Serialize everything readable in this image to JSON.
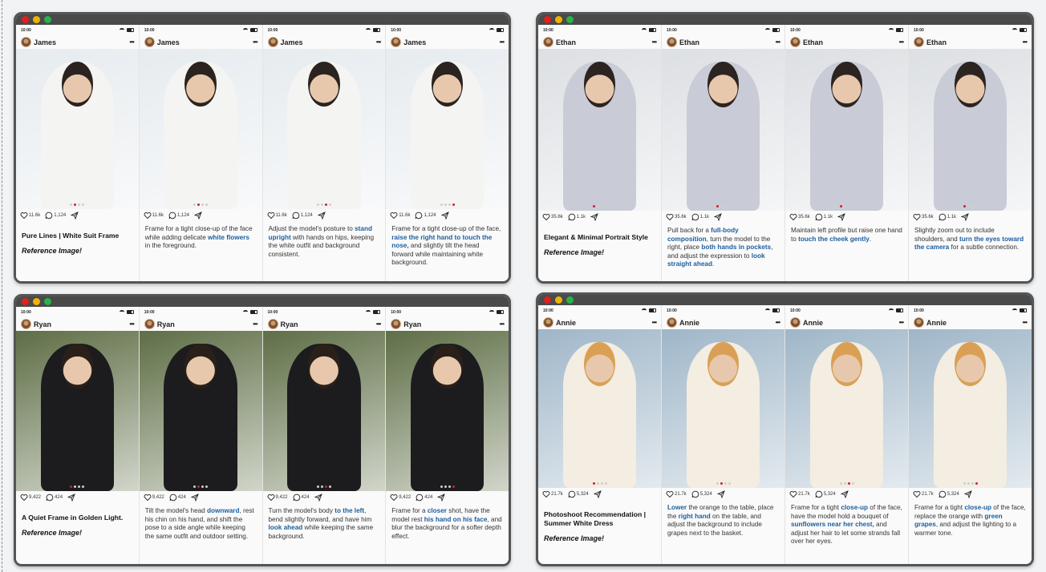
{
  "status_time": "10:00",
  "windows": [
    {
      "id": "james",
      "user": "James",
      "likes": "11.6k",
      "comments": "1,124",
      "title": "Pure Lines | White Suit Frame",
      "reference": "Reference Image!",
      "theme": {
        "bg": "#e6ebef",
        "figure": "#f4f4f2",
        "head": "#2a2320"
      },
      "panels": [
        {
          "active_dot": 1,
          "caption": []
        },
        {
          "active_dot": 1,
          "caption": [
            {
              "t": "Frame for a tight close-up of the face while adding delicate "
            },
            {
              "t": "white flowers",
              "hl": true
            },
            {
              "t": " in the foreground."
            }
          ]
        },
        {
          "active_dot": 2,
          "caption": [
            {
              "t": "Adjust the model's posture to "
            },
            {
              "t": "stand upright",
              "hl": true
            },
            {
              "t": " with hands on hips, keeping the white outfit and background consistent."
            }
          ]
        },
        {
          "active_dot": 3,
          "caption": [
            {
              "t": "Frame for a tight close-up of the face, "
            },
            {
              "t": "raise the right hand to touch the nose,",
              "hl": true
            },
            {
              "t": " and slightly tilt the head forward while maintaining white background."
            }
          ]
        }
      ]
    },
    {
      "id": "ethan",
      "user": "Ethan",
      "likes": "35.6k",
      "comments": "1.1k",
      "title": "Elegant & Minimal Portrait Style",
      "reference": "Reference Image!",
      "theme": {
        "bg": "#dcdfe3",
        "figure": "#c9ccd6",
        "head": "#2c2420"
      },
      "panels": [
        {
          "active_dot": 0,
          "caption": []
        },
        {
          "active_dot": 0,
          "caption": [
            {
              "t": "Pull back for a "
            },
            {
              "t": "full-body composition",
              "hl": true
            },
            {
              "t": ", turn the model to the right, place "
            },
            {
              "t": "both hands in pockets",
              "hl": true
            },
            {
              "t": ", and adjust the expression to "
            },
            {
              "t": "look straight ahead",
              "hl": true
            },
            {
              "t": "."
            }
          ]
        },
        {
          "active_dot": 0,
          "caption": [
            {
              "t": "Maintain left profile but raise one hand to "
            },
            {
              "t": "touch the cheek gently",
              "hl": true
            },
            {
              "t": "."
            }
          ]
        },
        {
          "active_dot": 0,
          "caption": [
            {
              "t": "Slightly zoom out to include shoulders, and "
            },
            {
              "t": "turn the eyes toward the camera",
              "hl": true
            },
            {
              "t": " for a subtle connection."
            }
          ]
        }
      ]
    },
    {
      "id": "ryan",
      "user": "Ryan",
      "likes": "9,422",
      "comments": "424",
      "title": "A Quiet Frame in Golden Light.",
      "reference": "Reference Image!",
      "theme": {
        "bg": "#5e6e46",
        "figure": "#1c1c1e",
        "head": "#2a2019"
      },
      "panels": [
        {
          "active_dot": 0,
          "caption": []
        },
        {
          "active_dot": 1,
          "caption": [
            {
              "t": "Tilt the model's head "
            },
            {
              "t": "downward",
              "hl": true
            },
            {
              "t": ", rest his chin on his hand, and shift the pose to a side angle while keeping the same outfit and outdoor setting."
            }
          ]
        },
        {
          "active_dot": 2,
          "caption": [
            {
              "t": "Turn the model's body "
            },
            {
              "t": "to the left",
              "hl": true
            },
            {
              "t": ", bend slightly forward, and have him "
            },
            {
              "t": "look ahead",
              "hl": true
            },
            {
              "t": " while keeping the same background."
            }
          ]
        },
        {
          "active_dot": 3,
          "caption": [
            {
              "t": "Frame for a "
            },
            {
              "t": "closer",
              "hl": true
            },
            {
              "t": " shot, have the model rest "
            },
            {
              "t": "his hand on his face",
              "hl": true
            },
            {
              "t": ", and blur the background for a softer depth effect."
            }
          ]
        }
      ]
    },
    {
      "id": "annie",
      "user": "Annie",
      "likes": "21.7k",
      "comments": "5,324",
      "title": "Photoshoot Recommendation | Summer White Dress",
      "reference": "Reference Image!",
      "theme": {
        "bg": "#9fb6c8",
        "figure": "#f3ede2",
        "head": "#d9a055"
      },
      "panels": [
        {
          "active_dot": 0,
          "caption": []
        },
        {
          "active_dot": 1,
          "caption": [
            {
              "t": "Lower",
              "hl": true
            },
            {
              "t": " the orange to the table, place the "
            },
            {
              "t": "right hand",
              "hl": true
            },
            {
              "t": " on the table, and adjust the background to include grapes next to the basket."
            }
          ]
        },
        {
          "active_dot": 2,
          "caption": [
            {
              "t": "Frame for a tight "
            },
            {
              "t": "close-up",
              "hl": true
            },
            {
              "t": " of the face, have the model hold a bouquet of "
            },
            {
              "t": "sunflowers near her chest,",
              "hl": true
            },
            {
              "t": " and adjust her hair to let some strands fall over her eyes."
            }
          ]
        },
        {
          "active_dot": 3,
          "caption": [
            {
              "t": "Frame for a tight "
            },
            {
              "t": "close-up",
              "hl": true
            },
            {
              "t": " of the face, replace the orange with "
            },
            {
              "t": "green grapes",
              "hl": true
            },
            {
              "t": ", and adjust the lighting to a warmer tone."
            }
          ]
        }
      ]
    }
  ]
}
